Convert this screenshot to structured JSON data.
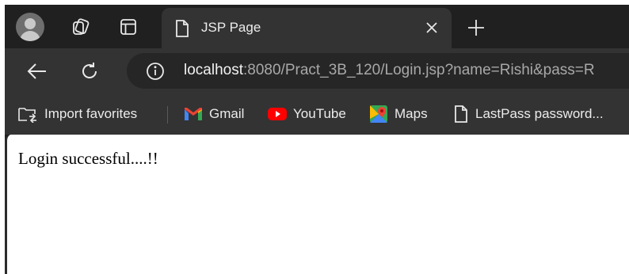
{
  "tab": {
    "title": "JSP Page"
  },
  "address_bar": {
    "host": "localhost",
    "rest": ":8080/Pract_3B_120/Login.jsp?name=Rishi&pass=R"
  },
  "bookmarks": [
    {
      "label": "Import favorites",
      "icon": "import-favorites-icon"
    },
    {
      "label": "Gmail",
      "icon": "gmail-icon"
    },
    {
      "label": "YouTube",
      "icon": "youtube-icon"
    },
    {
      "label": "Maps",
      "icon": "maps-icon"
    },
    {
      "label": "LastPass password...",
      "icon": "page-icon"
    }
  ],
  "page": {
    "message": "Login successful....!!"
  },
  "colors": {
    "chrome_dark": "#202020",
    "toolbar": "#333333",
    "omnibox": "#262626",
    "gmail_red": "#ea4335",
    "youtube_red": "#ff0000"
  }
}
